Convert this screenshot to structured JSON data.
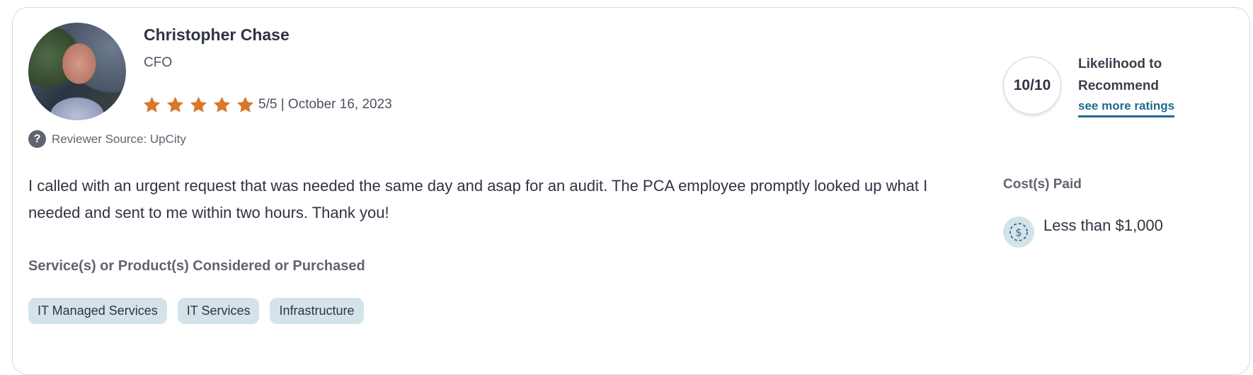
{
  "reviewer": {
    "name": "Christopher Chase",
    "title": "CFO",
    "rating_score": "5/5",
    "separator": "|",
    "date": "October 16, 2023",
    "stars_filled": 5,
    "stars_total": 5,
    "star_color": "#d9782a"
  },
  "source": {
    "icon": "question-icon",
    "glyph": "?",
    "text": "Reviewer Source: UpCity"
  },
  "review": {
    "body": "I called with an urgent request that was needed the same day and asap for an audit. The PCA employee promptly looked up what I needed and sent to me within two hours. Thank you!"
  },
  "services": {
    "heading": "Service(s) or Product(s) Considered or Purchased",
    "tags": [
      "IT Managed Services",
      "IT Services",
      "Infrastructure"
    ]
  },
  "recommend": {
    "score": "10/10",
    "label_line1": "Likelihood to",
    "label_line2": "Recommend",
    "link": "see more ratings"
  },
  "cost": {
    "heading": "Cost(s) Paid",
    "icon": "dollar-circle-icon",
    "value": "Less than $1,000"
  },
  "colors": {
    "accent_link": "#1f6a8f",
    "tag_bg": "#d4e3ea",
    "text": "#2f3442"
  }
}
